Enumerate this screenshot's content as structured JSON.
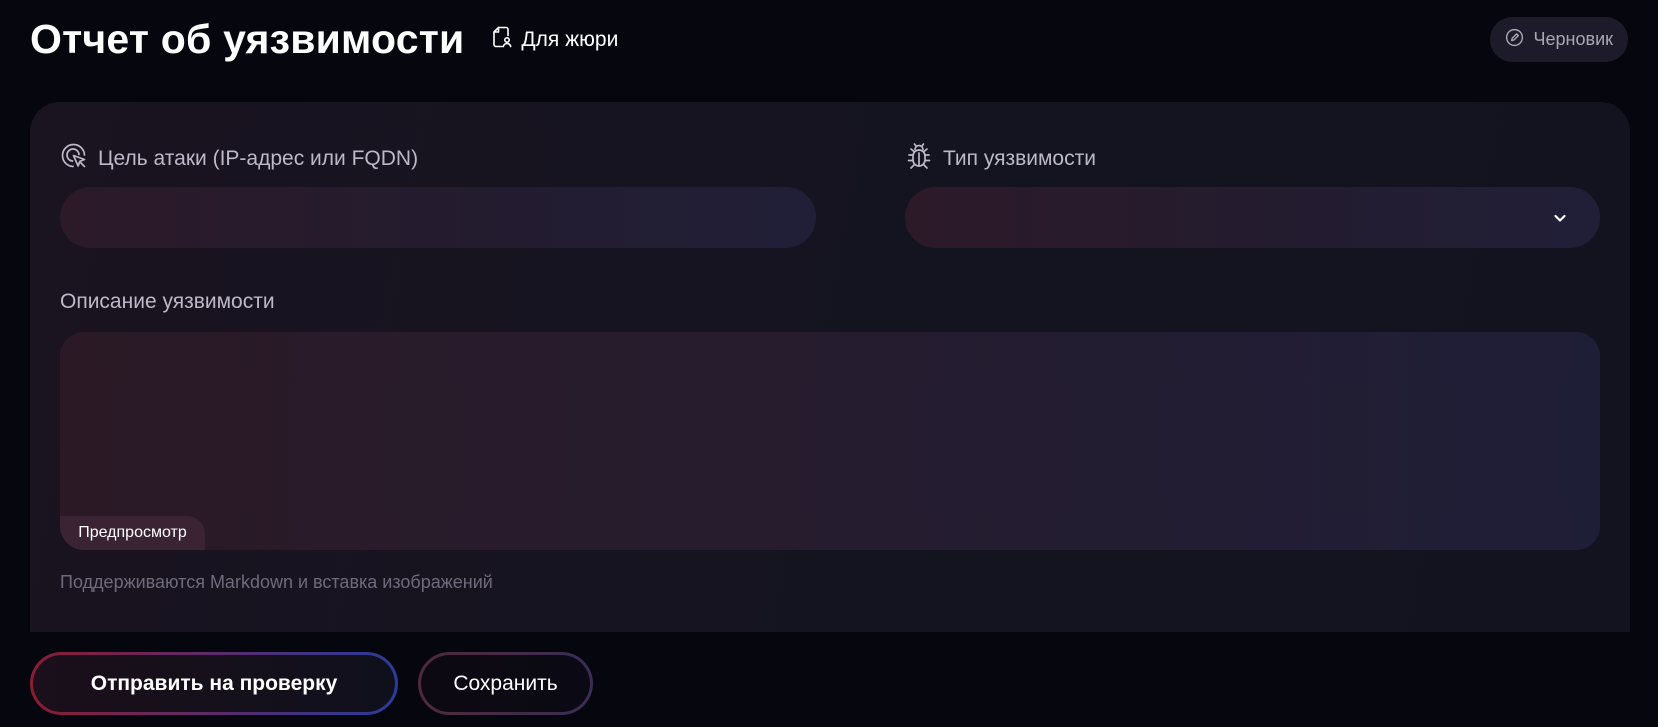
{
  "header": {
    "title": "Отчет об уязвимости",
    "jury_label": "Для жюри",
    "status_label": "Черновик"
  },
  "form": {
    "target": {
      "label": "Цель атаки (IP-адрес или FQDN)",
      "value": "",
      "placeholder": ""
    },
    "vuln_type": {
      "label": "Тип уязвимости",
      "selected": ""
    },
    "description": {
      "label": "Описание уязвимости",
      "value": "",
      "preview_tab": "Предпросмотр",
      "hint": "Поддерживаются Markdown и вставка изображений"
    }
  },
  "actions": {
    "submit_label": "Отправить на проверку",
    "save_label": "Сохранить"
  },
  "icons": {
    "jury": "document-user-icon",
    "status": "pencil-circle-icon",
    "target": "target-cursor-icon",
    "vuln_type": "bug-icon",
    "dropdown": "chevron-down-icon"
  },
  "colors": {
    "background": "#06060f",
    "card": "#16131f",
    "accent_red": "#8a1d34",
    "accent_blue": "#2a3b9a",
    "muted_text": "#6f6b7c"
  }
}
